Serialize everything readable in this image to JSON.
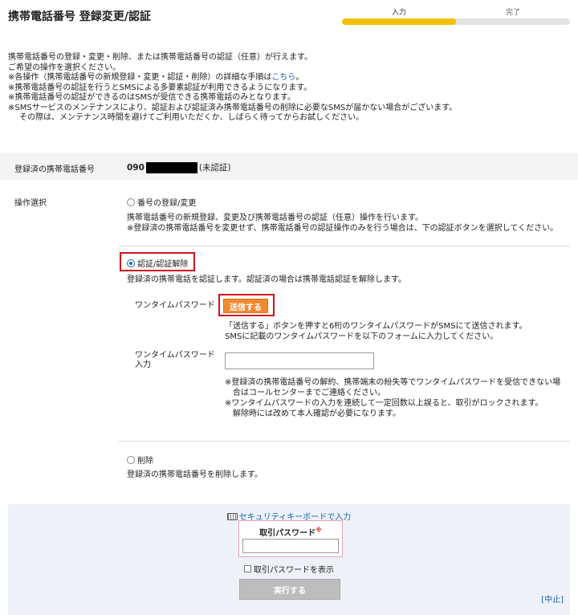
{
  "header": {
    "title": "携帯電話番号 登録変更/認証"
  },
  "progress": {
    "steps": [
      "入力",
      "完了"
    ],
    "current": "入力",
    "fill_fraction": 0.5
  },
  "intro": {
    "lines": [
      "携帯電話番号の登録・変更・削除、または携帯電話番号の認証（任意）が行えます。",
      "ご希望の操作を選択ください。",
      "※各操作（携帯電話番号の新規登録・変更・認証・削除）の詳細な手順は",
      "※携帯電話番号の認証を行うとSMSによる多要素認証が利用できるようになります。",
      "※携帯電話番号の認証ができるのはSMSが受信できる携帯電話のみとなります。",
      "※SMSサービスのメンテナンスにより、認証および認証済み携帯電話番号の削除に必要なSMSが届かない場合がございます。",
      "その際は、メンテナンス時間を避けてご利用いただくか、しばらく待ってからお試しください。"
    ],
    "link_text": "こちら",
    "link_suffix": "。"
  },
  "registered": {
    "label": "登録済の携帯電話番号",
    "prefix": "090",
    "status": "(未認証)"
  },
  "operation": {
    "label": "操作選択",
    "opt1": {
      "label": "番号の登録/変更",
      "desc1": "携帯電話番号の新規登録、変更及び携帯電話番号の認証（任意）操作を行います。",
      "desc2": "※登録済の携帯電話番号を変更せず、携帯電話番号の認証操作のみを行う場合は、下の認証ボタンを選択してください。"
    },
    "opt2": {
      "label": "認証/認証解除",
      "desc": "登録済の携帯電話を認証します。認証済の場合は携帯電話認証を解除します。",
      "otp_label": "ワンタイムパスワード",
      "send_button": "送信する",
      "send_note1": "「送信する」ボタンを押すと6桁のワンタイムパスワードがSMSにて送信されます。",
      "send_note2": "SMSに記載のワンタイムパスワードを以下のフォームに入力してください。",
      "otp_input_label1": "ワンタイムパスワード",
      "otp_input_label2": "入力",
      "notes": [
        "※登録済の携帯電話番号の解約、携帯端末の紛失等でワンタイムパスワードを受信できない場",
        "合はコールセンターまでご連絡ください。",
        "※ワンタイムパスワードの入力を連続して一定回数以上誤ると、取引がロックされます。",
        "解除時には改めて本人確認が必要になります。"
      ]
    },
    "opt3": {
      "label": "削除",
      "desc": "登録済の携帯電話番号を削除します。"
    },
    "selected": "認証/認証解除"
  },
  "footer": {
    "keyboard_link": "セキュリティキーボードで入力",
    "password_label": "取引パスワード",
    "required_mark": "※",
    "show_password": "取引パスワードを表示",
    "execute_button": "実行する",
    "cancel_link": "[中止]"
  },
  "colors": {
    "accent": "#f2c200",
    "send_button": "#f08a2e",
    "highlight": "#d0121b",
    "link": "#1a5fb4"
  }
}
